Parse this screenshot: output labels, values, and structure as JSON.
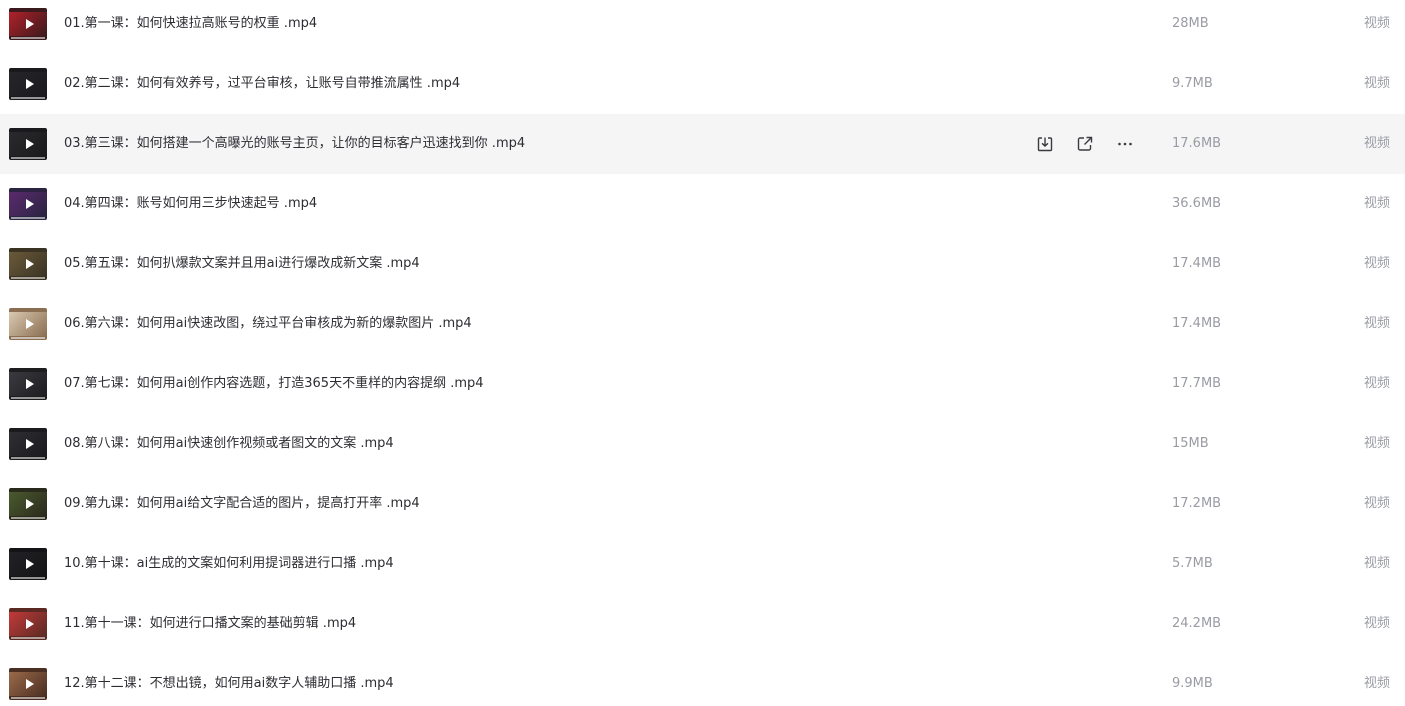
{
  "files": [
    {
      "name": "01.第一课：如何快速拉高账号的权重 .mp4",
      "size": "28MB",
      "type": "视频",
      "thumb": [
        "#b1212b",
        "#3a1a1c"
      ]
    },
    {
      "name": "02.第二课：如何有效养号，过平台审核，让账号自带推流属性 .mp4",
      "size": "9.7MB",
      "type": "视频",
      "thumb": [
        "#26262a",
        "#1a1a1d"
      ]
    },
    {
      "name": "03.第三课：如何搭建一个高曝光的账号主页，让你的目标客户迅速找到你 .mp4",
      "size": "17.6MB",
      "type": "视频",
      "thumb": [
        "#2a2a2d",
        "#1a1a1d"
      ]
    },
    {
      "name": "04.第四课：账号如何用三步快速起号 .mp4",
      "size": "36.6MB",
      "type": "视频",
      "thumb": [
        "#5b2a6e",
        "#2a2440"
      ]
    },
    {
      "name": "05.第五课：如何扒爆款文案并且用ai进行爆改成新文案 .mp4",
      "size": "17.4MB",
      "type": "视频",
      "thumb": [
        "#6b5a3a",
        "#3a3324"
      ]
    },
    {
      "name": "06.第六课：如何用ai快速改图，绕过平台审核成为新的爆款图片 .mp4",
      "size": "17.4MB",
      "type": "视频",
      "thumb": [
        "#d9c9b0",
        "#8a6e52"
      ]
    },
    {
      "name": "07.第七课：如何用ai创作内容选题，打造365天不重样的内容提纲 .mp4",
      "size": "17.7MB",
      "type": "视频",
      "thumb": [
        "#3a3a40",
        "#1d1d20"
      ]
    },
    {
      "name": "08.第八课：如何用ai快速创作视频或者图文的文案 .mp4",
      "size": "15MB",
      "type": "视频",
      "thumb": [
        "#2e2e33",
        "#1b1b1e"
      ]
    },
    {
      "name": "09.第九课：如何用ai给文字配合适的图片，提高打开率 .mp4",
      "size": "17.2MB",
      "type": "视频",
      "thumb": [
        "#4a5a2e",
        "#2a2a1c"
      ]
    },
    {
      "name": "10.第十课：ai生成的文案如何利用提词器进行口播 .mp4",
      "size": "5.7MB",
      "type": "视频",
      "thumb": [
        "#222226",
        "#141416"
      ]
    },
    {
      "name": "11.第十一课：如何进行口播文案的基础剪辑 .mp4",
      "size": "24.2MB",
      "type": "视频",
      "thumb": [
        "#c23a3a",
        "#5a2a22"
      ]
    },
    {
      "name": "12.第十二课：不想出镜，如何用ai数字人辅助口播 .mp4",
      "size": "9.9MB",
      "type": "视频",
      "thumb": [
        "#9a6a4a",
        "#4a2e22"
      ]
    }
  ],
  "hover_row": 2,
  "actions": {
    "download_icon": "download-icon",
    "share_icon": "share-icon",
    "more_icon": "more-icon"
  }
}
